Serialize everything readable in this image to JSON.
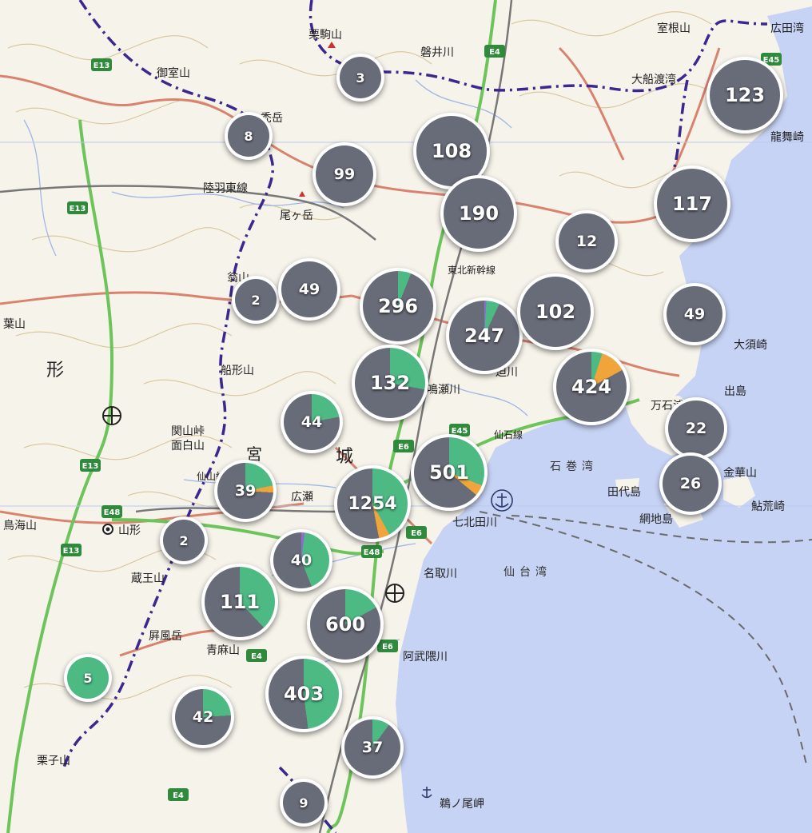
{
  "colors": {
    "sea": "#c7d3f5",
    "land": "#f6f3ea",
    "cluster_base": "#686b78",
    "cluster_green": "#4dba84",
    "cluster_orange": "#f0a53a",
    "cluster_purple": "#8a6fd1"
  },
  "labels": {
    "place": [
      "広田湾",
      "大船渡湾",
      "室根山",
      "龍舞崎",
      "大須崎",
      "出島",
      "金華山",
      "網地島",
      "田代島",
      "鮎荒崎",
      "石巻湾",
      "七北田川",
      "名取川",
      "仙台湾",
      "阿武隈川",
      "鵜ノ尾岬",
      "栗駒山",
      "磐井川",
      "禿岳",
      "尾ヶ岳",
      "陸羽東線",
      "御室山",
      "翁山",
      "船形山",
      "関山峠",
      "面白山",
      "宮",
      "城",
      "形",
      "葉山",
      "山形",
      "蔵王山",
      "屛風岳",
      "青麻山",
      "鳥海山",
      "栗子山",
      "広瀬",
      "万石浦",
      "鳴瀬川",
      "迫川",
      "東北新幹線",
      "仙石線",
      "仙山線"
    ],
    "roads": [
      "E4",
      "E13",
      "E6",
      "E45",
      "E48"
    ]
  },
  "clusters": [
    {
      "id": "c-3",
      "count": "3",
      "green": 0,
      "orange": 0,
      "purple": 0
    },
    {
      "id": "c-8",
      "count": "8",
      "green": 0,
      "orange": 0,
      "purple": 0
    },
    {
      "id": "c-99",
      "count": "99",
      "green": 0,
      "orange": 0,
      "purple": 0
    },
    {
      "id": "c-108",
      "count": "108",
      "green": 0,
      "orange": 0,
      "purple": 0
    },
    {
      "id": "c-123",
      "count": "123",
      "green": 0,
      "orange": 0,
      "purple": 0
    },
    {
      "id": "c-190",
      "count": "190",
      "green": 0,
      "orange": 0,
      "purple": 0
    },
    {
      "id": "c-117",
      "count": "117",
      "green": 0,
      "orange": 0,
      "purple": 0
    },
    {
      "id": "c-12",
      "count": "12",
      "green": 0,
      "orange": 0,
      "purple": 0
    },
    {
      "id": "c-2a",
      "count": "2",
      "green": 0,
      "orange": 0,
      "purple": 0
    },
    {
      "id": "c-49a",
      "count": "49",
      "green": 0,
      "orange": 0,
      "purple": 0
    },
    {
      "id": "c-296",
      "count": "296",
      "green": 0.06,
      "orange": 0,
      "purple": 0
    },
    {
      "id": "c-247",
      "count": "247",
      "green": 0.06,
      "orange": 0,
      "purple": 0.01
    },
    {
      "id": "c-102",
      "count": "102",
      "green": 0,
      "orange": 0,
      "purple": 0
    },
    {
      "id": "c-49b",
      "count": "49",
      "green": 0,
      "orange": 0,
      "purple": 0
    },
    {
      "id": "c-132",
      "count": "132",
      "green": 0.28,
      "orange": 0,
      "purple": 0
    },
    {
      "id": "c-424",
      "count": "424",
      "green": 0.05,
      "orange": 0.12,
      "purple": 0
    },
    {
      "id": "c-44",
      "count": "44",
      "green": 0.22,
      "orange": 0,
      "purple": 0
    },
    {
      "id": "c-22",
      "count": "22",
      "green": 0,
      "orange": 0,
      "purple": 0
    },
    {
      "id": "c-501",
      "count": "501",
      "green": 0.31,
      "orange": 0.05,
      "purple": 0
    },
    {
      "id": "c-26",
      "count": "26",
      "green": 0,
      "orange": 0,
      "purple": 0
    },
    {
      "id": "c-39",
      "count": "39",
      "green": 0.22,
      "orange": 0.04,
      "purple": 0
    },
    {
      "id": "c-1254",
      "count": "1254",
      "green": 0.42,
      "orange": 0.05,
      "purple": 0
    },
    {
      "id": "c-2b",
      "count": "2",
      "green": 0,
      "orange": 0,
      "purple": 0
    },
    {
      "id": "c-40",
      "count": "40",
      "green": 0.42,
      "orange": 0,
      "purple": 0.02
    },
    {
      "id": "c-111",
      "count": "111",
      "green": 0.38,
      "orange": 0,
      "purple": 0
    },
    {
      "id": "c-600",
      "count": "600",
      "green": 0.17,
      "orange": 0,
      "purple": 0
    },
    {
      "id": "c-5",
      "count": "5",
      "green": 1,
      "orange": 0,
      "purple": 0
    },
    {
      "id": "c-403",
      "count": "403",
      "green": 0.48,
      "orange": 0,
      "purple": 0
    },
    {
      "id": "c-42",
      "count": "42",
      "green": 0.24,
      "orange": 0,
      "purple": 0
    },
    {
      "id": "c-37",
      "count": "37",
      "green": 0.1,
      "orange": 0,
      "purple": 0
    },
    {
      "id": "c-9",
      "count": "9",
      "green": 0,
      "orange": 0,
      "purple": 0
    }
  ]
}
